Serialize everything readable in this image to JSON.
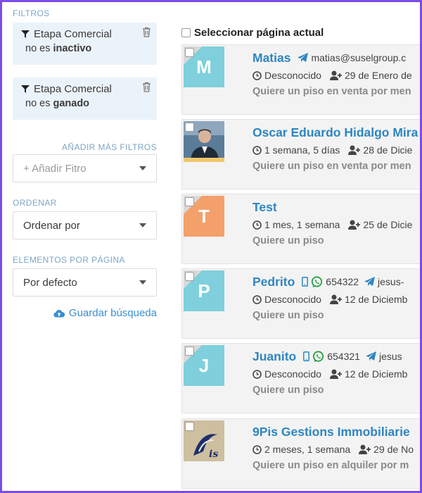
{
  "sidebar": {
    "filters_label": "FILTROS",
    "filters": [
      {
        "title": "Etapa Comercial",
        "op": "no es",
        "value": "inactivo"
      },
      {
        "title": "Etapa Comercial",
        "op": "no es",
        "value": "ganado"
      }
    ],
    "add_filters_label": "AÑADIR MÁS FILTROS",
    "add_filter_placeholder": "+ Añadir Fitro",
    "order_label": "ORDENAR",
    "order_value": "Ordenar por",
    "per_page_label": "ELEMENTOS POR PÁGINA",
    "per_page_value": "Por defecto",
    "save_search": "Guardar búsqueda"
  },
  "main": {
    "select_page_label": "Seleccionar página actual",
    "contacts": [
      {
        "initial": "M",
        "avatar_color": "#7fd0dc",
        "name": "Matias",
        "email": "matias@suselgroup.c",
        "last_contact": "Desconocido",
        "created": "29 de Enero de",
        "wants": "Quiere un piso en venta por men"
      },
      {
        "initial": "",
        "avatar_color": "#4a6d8c",
        "name": "Oscar Eduardo Hidalgo Mira",
        "last_contact": "1 semana, 5 días",
        "created": "28 de Dicie",
        "wants": "Quiere un piso en venta por men"
      },
      {
        "initial": "T",
        "avatar_color": "#f4a06b",
        "name": "Test",
        "last_contact": "1 mes, 1 semana",
        "created": "25 de Dicie",
        "wants": "Quiere un piso"
      },
      {
        "initial": "P",
        "avatar_color": "#7fd0dc",
        "name": "Pedrito",
        "phone": "654322",
        "email": "jesus-",
        "last_contact": "Desconocido",
        "created": "12 de Diciemb",
        "wants": "Quiere un piso"
      },
      {
        "initial": "J",
        "avatar_color": "#7fd0dc",
        "name": "Juanito",
        "phone": "654321",
        "email": "jesus",
        "last_contact": "Desconocido",
        "created": "12 de Diciemb",
        "wants": "Quiere un piso"
      },
      {
        "initial": "",
        "avatar_color": "#c8b89a",
        "name": "9Pis Gestions Immobiliarie",
        "last_contact": "2 meses, 1 semana",
        "created": "29 de No",
        "wants": "Quiere un piso en alquiler por m"
      }
    ]
  },
  "colors": {
    "accent": "#2e86c1",
    "frame": "#7b4be6",
    "filter_bg": "#ebf3fa"
  }
}
